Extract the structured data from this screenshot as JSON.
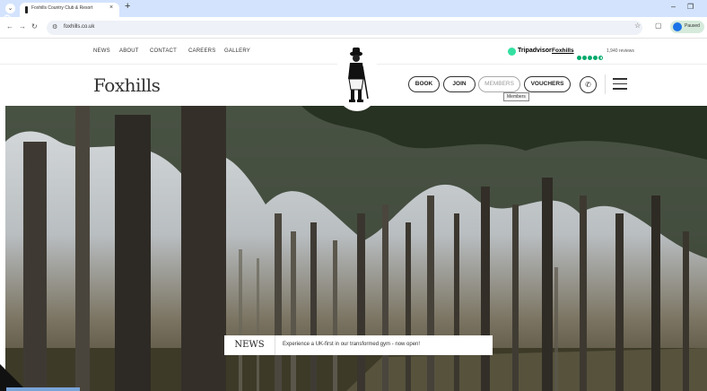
{
  "browser": {
    "tab_title": "Foxhills Country Club & Resort",
    "tab_close": "×",
    "new_tab": "+",
    "url": "foxhills.co.uk",
    "profile_label": "Paused",
    "nav": {
      "back": "←",
      "forward": "→",
      "reload": "↻"
    },
    "icons": [
      "site-settings-icon",
      "star-icon",
      "extensions-icon",
      "minimize-icon",
      "maximize-icon"
    ]
  },
  "topnav": {
    "links": [
      "NEWS",
      "ABOUT",
      "CONTACT",
      "CAREERS",
      "GALLERY"
    ]
  },
  "tripadvisor": {
    "brand": "Tripadvisor",
    "venue": "Foxhills",
    "rating_out_of_5": 4.5,
    "reviews": "1,940 reviews"
  },
  "header": {
    "logo": "Foxhills",
    "buttons": {
      "book": "BOOK",
      "join": "JOIN",
      "members": "MEMBERS",
      "vouchers": "VOUCHERS"
    },
    "members_tooltip": "Members",
    "phone_icon": "phone-icon",
    "menu_icon": "hamburger-menu-icon"
  },
  "news": {
    "label": "NEWS",
    "headline": "Experience a UK-first in our transformed gym - now open!"
  },
  "colors": {
    "tabstrip": "#d3e3fd",
    "tripadvisor_green": "#34e0a1",
    "rating_green": "#00aa6c"
  }
}
